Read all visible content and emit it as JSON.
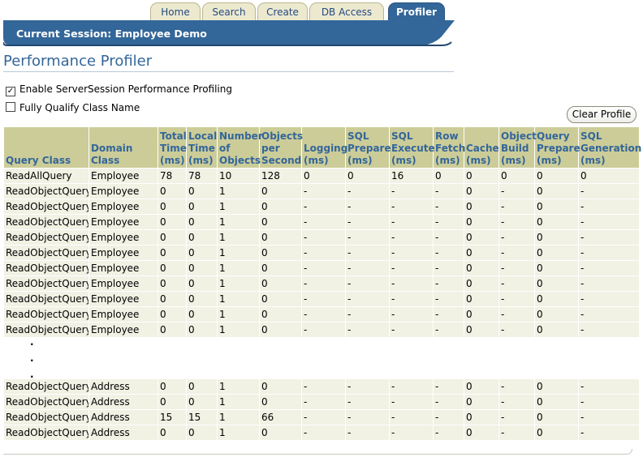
{
  "tabs": [
    {
      "label": "Home"
    },
    {
      "label": "Search"
    },
    {
      "label": "Create"
    },
    {
      "label": "DB Access"
    },
    {
      "label": "Profiler"
    }
  ],
  "session": {
    "title": "Current Session: Employee Demo"
  },
  "page": {
    "title": "Performance Profiler"
  },
  "options": {
    "enable_profiling": {
      "label": "Enable ServerSession Performance Profiling",
      "checked": true
    },
    "fully_qualify": {
      "label": "Fully Qualify Class Name",
      "checked": false
    }
  },
  "clear_button": {
    "label": "Clear Profile"
  },
  "table": {
    "headers": [
      {
        "label": "Query Class"
      },
      {
        "label": "Domain Class"
      },
      {
        "label": "Total Time (ms)"
      },
      {
        "label": "Local Time (ms)"
      },
      {
        "label": "Number of Objects"
      },
      {
        "label": "Objects per Second"
      },
      {
        "label": "Logging (ms)"
      },
      {
        "label": "SQL Prepare (ms)"
      },
      {
        "label": "SQL Execute (ms)"
      },
      {
        "label": "Row Fetch (ms)"
      },
      {
        "label": "Cache (ms)"
      },
      {
        "label": "Object Build (ms)"
      },
      {
        "label": "Query Prepare (ms)"
      },
      {
        "label": "SQL Generation (ms)"
      }
    ],
    "rows_top": [
      [
        "ReadAllQuery",
        "Employee",
        "78",
        "78",
        "10",
        "128",
        "0",
        "0",
        "16",
        "0",
        "0",
        "0",
        "0",
        "0"
      ],
      [
        "ReadObjectQuery",
        "Employee",
        "0",
        "0",
        "1",
        "0",
        "-",
        "-",
        "-",
        "-",
        "0",
        "-",
        "0",
        "-"
      ],
      [
        "ReadObjectQuery",
        "Employee",
        "0",
        "0",
        "1",
        "0",
        "-",
        "-",
        "-",
        "-",
        "0",
        "-",
        "0",
        "-"
      ],
      [
        "ReadObjectQuery",
        "Employee",
        "0",
        "0",
        "1",
        "0",
        "-",
        "-",
        "-",
        "-",
        "0",
        "-",
        "0",
        "-"
      ],
      [
        "ReadObjectQuery",
        "Employee",
        "0",
        "0",
        "1",
        "0",
        "-",
        "-",
        "-",
        "-",
        "0",
        "-",
        "0",
        "-"
      ],
      [
        "ReadObjectQuery",
        "Employee",
        "0",
        "0",
        "1",
        "0",
        "-",
        "-",
        "-",
        "-",
        "0",
        "-",
        "0",
        "-"
      ],
      [
        "ReadObjectQuery",
        "Employee",
        "0",
        "0",
        "1",
        "0",
        "-",
        "-",
        "-",
        "-",
        "0",
        "-",
        "0",
        "-"
      ],
      [
        "ReadObjectQuery",
        "Employee",
        "0",
        "0",
        "1",
        "0",
        "-",
        "-",
        "-",
        "-",
        "0",
        "-",
        "0",
        "-"
      ],
      [
        "ReadObjectQuery",
        "Employee",
        "0",
        "0",
        "1",
        "0",
        "-",
        "-",
        "-",
        "-",
        "0",
        "-",
        "0",
        "-"
      ],
      [
        "ReadObjectQuery",
        "Employee",
        "0",
        "0",
        "1",
        "0",
        "-",
        "-",
        "-",
        "-",
        "0",
        "-",
        "0",
        "-"
      ],
      [
        "ReadObjectQuery",
        "Employee",
        "0",
        "0",
        "1",
        "0",
        "-",
        "-",
        "-",
        "-",
        "0",
        "-",
        "0",
        "-"
      ]
    ],
    "rows_bottom": [
      [
        "ReadObjectQuery",
        "Address",
        "0",
        "0",
        "1",
        "0",
        "-",
        "-",
        "-",
        "-",
        "0",
        "-",
        "0",
        "-"
      ],
      [
        "ReadObjectQuery",
        "Address",
        "0",
        "0",
        "1",
        "0",
        "-",
        "-",
        "-",
        "-",
        "0",
        "-",
        "0",
        "-"
      ],
      [
        "ReadObjectQuery",
        "Address",
        "15",
        "15",
        "1",
        "66",
        "-",
        "-",
        "-",
        "-",
        "0",
        "-",
        "0",
        "-"
      ],
      [
        "ReadObjectQuery",
        "Address",
        "0",
        "0",
        "1",
        "0",
        "-",
        "-",
        "-",
        "-",
        "0",
        "-",
        "0",
        "-"
      ]
    ]
  },
  "colors": {
    "accent": "#336699",
    "header_bg": "#cccc99",
    "cell_bg": "#f1f1e4",
    "tab_bg": "#ece9cf"
  }
}
